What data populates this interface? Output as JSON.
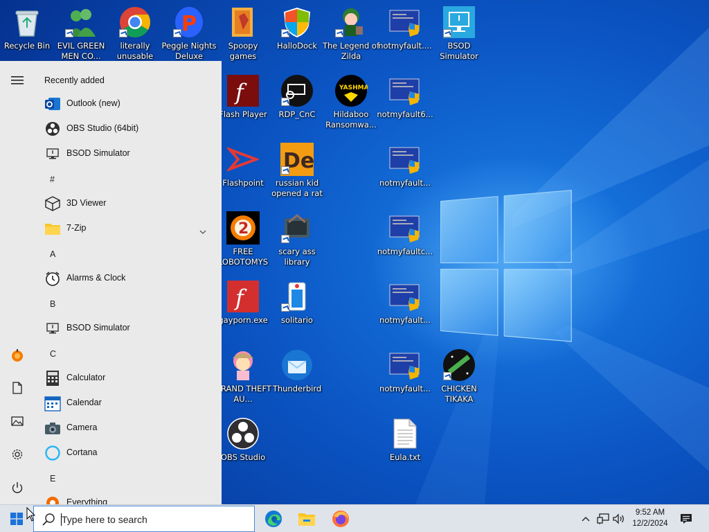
{
  "desktop": {
    "icons": [
      {
        "name": "recycle-bin-icon",
        "label": "Recycle Bin"
      },
      {
        "name": "evil-green-men-icon",
        "label": "EVIL GREEN MEN CO..."
      },
      {
        "name": "chrome-icon",
        "label": "literally unusable"
      },
      {
        "name": "peggle-icon",
        "label": "Peggle Nights Deluxe"
      },
      {
        "name": "spoopy-games-icon",
        "label": "Spoopy games"
      },
      {
        "name": "hallodock-icon",
        "label": "HalloDock"
      },
      {
        "name": "zilda-icon",
        "label": "The Legend of Zilda"
      },
      {
        "name": "notmyfault-icon",
        "label": "notmyfault...."
      },
      {
        "name": "bsod-simulator-icon",
        "label": "BSOD Simulator"
      },
      {
        "name": "flash-player-icon",
        "label": "Flash Player"
      },
      {
        "name": "rdp-cnc-icon",
        "label": "RDP_CnC"
      },
      {
        "name": "hildaboo-icon",
        "label": "Hildaboo Ransomwa..."
      },
      {
        "name": "notmyfault-icon",
        "label": "notmyfault6..."
      },
      {
        "name": "flashpoint-icon",
        "label": "Flashpoint"
      },
      {
        "name": "russian-kid-icon",
        "label": "russian kid opened a rat"
      },
      {
        "name": "notmyfault-icon",
        "label": "notmyfault..."
      },
      {
        "name": "free-lobotomys-icon",
        "label": "FREE LOBOTOMYS"
      },
      {
        "name": "scary-library-icon",
        "label": "scary ass library"
      },
      {
        "name": "notmyfault-icon",
        "label": "notmyfaultc..."
      },
      {
        "name": "flash-exe-icon",
        "label": "gayporn.exe"
      },
      {
        "name": "solitario-icon",
        "label": "solitario"
      },
      {
        "name": "notmyfault-icon",
        "label": "notmyfault..."
      },
      {
        "name": "gta-anime-icon",
        "label": "GRAND THEFT AU..."
      },
      {
        "name": "thunderbird-icon",
        "label": "Thunderbird"
      },
      {
        "name": "notmyfault-icon",
        "label": "notmyfault..."
      },
      {
        "name": "chicken-tikaka-icon",
        "label": "CHICKEN TIKAKA"
      },
      {
        "name": "obs-studio-icon",
        "label": "OBS Studio"
      },
      {
        "name": "text-file-icon",
        "label": "Eula.txt"
      }
    ]
  },
  "start_menu": {
    "recently_added_header": "Recently added",
    "recent": [
      {
        "label": "Outlook (new)",
        "icon": "outlook-icon"
      },
      {
        "label": "OBS Studio (64bit)",
        "icon": "obs-icon"
      },
      {
        "label": "BSOD Simulator",
        "icon": "bsod-icon"
      }
    ],
    "groups": [
      {
        "letter": "#",
        "apps": [
          {
            "label": "3D Viewer",
            "icon": "cube-icon"
          },
          {
            "label": "7-Zip",
            "icon": "folder-icon",
            "expandable": true
          }
        ]
      },
      {
        "letter": "A",
        "apps": [
          {
            "label": "Alarms & Clock",
            "icon": "clock-icon"
          }
        ]
      },
      {
        "letter": "B",
        "apps": [
          {
            "label": "BSOD Simulator",
            "icon": "bsod-icon"
          }
        ]
      },
      {
        "letter": "C",
        "apps": [
          {
            "label": "Calculator",
            "icon": "calculator-icon"
          },
          {
            "label": "Calendar",
            "icon": "calendar-icon"
          },
          {
            "label": "Camera",
            "icon": "camera-icon"
          },
          {
            "label": "Cortana",
            "icon": "cortana-icon"
          }
        ]
      },
      {
        "letter": "E",
        "apps": [
          {
            "label": "Everything",
            "icon": "everything-icon"
          }
        ]
      }
    ]
  },
  "taskbar": {
    "search_placeholder": "Type here to search",
    "pinned": [
      "edge-icon",
      "file-explorer-icon",
      "firefox-icon"
    ],
    "clock": {
      "time": "9:52 AM",
      "date": "12/2/2024"
    }
  },
  "colors": {
    "accent": "#0b55c4",
    "start_bg": "#eaeaea",
    "taskbar_bg": "#dfe3ea"
  }
}
